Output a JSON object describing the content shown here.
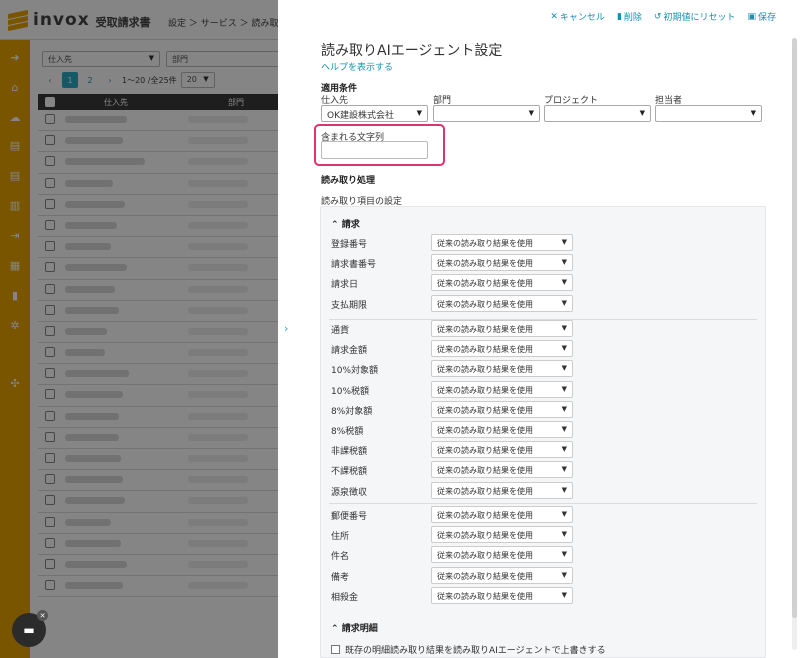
{
  "app": {
    "logo_text": "invox",
    "product": "受取請求書",
    "breadcrumb": "設定 ＞ サービス ＞ 読み取り"
  },
  "list": {
    "filter_supplier_placeholder": "仕入先",
    "filter_dept_placeholder": "部門",
    "pages": [
      "1",
      "2"
    ],
    "range_text": "1〜20 /全25件",
    "per_page": "20",
    "col_supplier": "仕入先",
    "col_dept": "部門"
  },
  "drawer": {
    "actions": {
      "cancel": "キャンセル",
      "delete": "削除",
      "reset": "初期値にリセット",
      "save": "保存"
    },
    "title": "読み取りAIエージェント設定",
    "help_link": "ヘルプを表示する",
    "conditions": {
      "heading": "適用条件",
      "supplier_label": "仕入先",
      "supplier_value": "OK建設株式会社",
      "dept_label": "部門",
      "project_label": "プロジェクト",
      "owner_label": "担当者",
      "contains_label": "含まれる文字列",
      "contains_value": ""
    },
    "processing": {
      "heading": "読み取り処理",
      "items_label": "読み取り項目の設定",
      "group_invoice": "請求",
      "default_option": "従来の読み取り結果を使用",
      "fields_group1": [
        "登録番号",
        "請求書番号",
        "請求日",
        "支払期限"
      ],
      "fields_group2": [
        "通貨",
        "請求金額",
        "10%対象額",
        "10%税額",
        "8%対象額",
        "8%税額",
        "非課税額",
        "不課税額",
        "源泉徴収"
      ],
      "fields_group3": [
        "郵便番号",
        "住所",
        "件名",
        "備考",
        "相殺金"
      ],
      "group_detail": "請求明細",
      "detail_checkbox_label": "既存の明細読み取り結果を読み取りAIエージェントで上書きする"
    }
  },
  "colors": {
    "accent": "#1a8fb0",
    "brand": "#e8a300",
    "highlight": "#e0336c"
  }
}
